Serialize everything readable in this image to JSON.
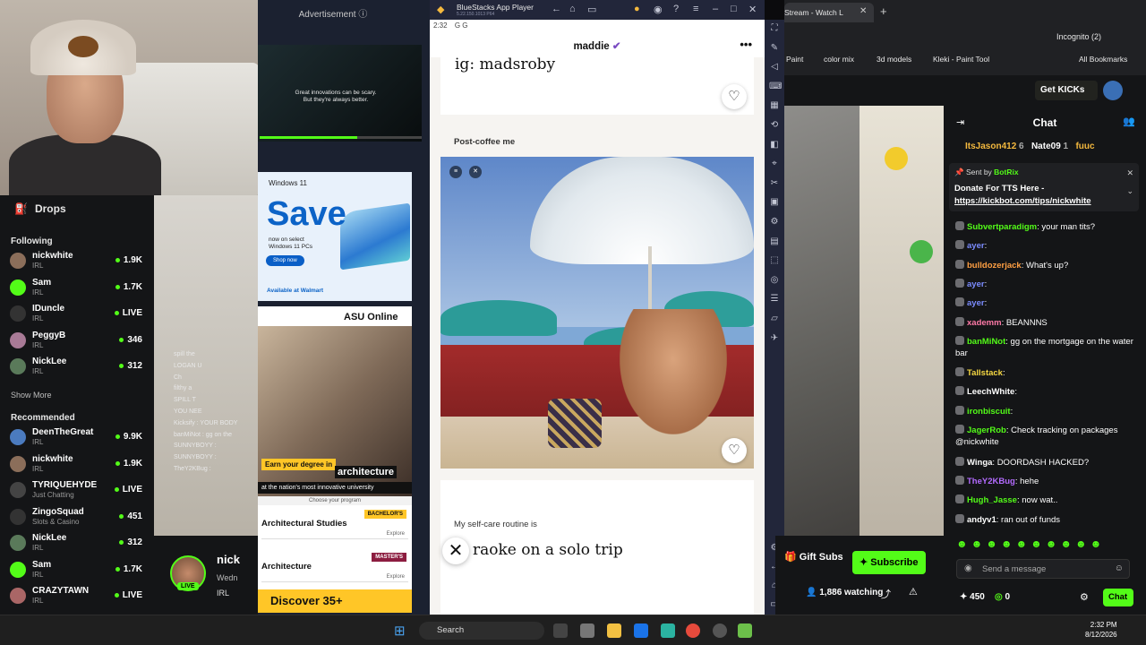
{
  "webcam": {
    "label": "webcam"
  },
  "sidebar": {
    "drops_label": "Drops",
    "following_label": "Following",
    "following": [
      {
        "name": "nickwhite",
        "category": "IRL",
        "count": "1.9K",
        "color": "#8b6e5a"
      },
      {
        "name": "Sam",
        "category": "IRL",
        "count": "1.7K",
        "color": "#53fc18"
      },
      {
        "name": "IDuncle",
        "category": "IRL",
        "count": "LIVE",
        "color": "#333333"
      },
      {
        "name": "PeggyB",
        "category": "IRL",
        "count": "346",
        "color": "#a87a96"
      },
      {
        "name": "NickLee",
        "category": "IRL",
        "count": "312",
        "color": "#5a7a5a"
      }
    ],
    "show_more": "Show More",
    "recommended_label": "Recommended",
    "recommended": [
      {
        "name": "DeenTheGreat",
        "category": "IRL",
        "count": "9.9K",
        "color": "#4b7bbf"
      },
      {
        "name": "nickwhite",
        "category": "IRL",
        "count": "1.9K",
        "color": "#8b6e5a"
      },
      {
        "name": "TYRIQUEHYDE",
        "category": "Just Chatting",
        "count": "LIVE",
        "color": "#444444"
      },
      {
        "name": "ZingoSquad",
        "category": "Slots & Casino",
        "count": "451",
        "color": "#333333"
      },
      {
        "name": "NickLee",
        "category": "IRL",
        "count": "312",
        "color": "#5a7a5a"
      },
      {
        "name": "Sam",
        "category": "IRL",
        "count": "1.7K",
        "color": "#53fc18"
      },
      {
        "name": "CRAZYTAWN",
        "category": "IRL",
        "count": "LIVE",
        "color": "#aa6666"
      }
    ]
  },
  "stream_overlay_chat": [
    "spill the",
    "LOGAN U",
    "Ch",
    "",
    "",
    "filthy a",
    "",
    "SPILL T",
    "YOU NEE",
    "Kicksify : YOUR BODY",
    "banMiNot : gg on the",
    "SUNNYBOYY :",
    "SUNNYBOYY :",
    "TheY2KBug :"
  ],
  "streamer": {
    "name": "nick",
    "date": "Wedn",
    "live": "LIVE",
    "tag": "IRL"
  },
  "ads": {
    "label": "Advertisement ⓘ",
    "video_text_1": "Great innovations can be scary.",
    "video_text_2": "But they're always better.",
    "video_progress": 0.6,
    "windows": {
      "brand": "Windows 11",
      "headline": "Save",
      "copy_1": "now on select",
      "copy_2": "Windows 11 PCs",
      "cta": "Shop now",
      "availability": "Available at Walmart"
    },
    "asu": {
      "logo": "ASU Online",
      "caption": "Earn your degree in",
      "caption_word": "architecture",
      "tagline": "at the nation's most innovative university",
      "choose": "Choose your program",
      "programs": [
        {
          "name": "Architectural Studies",
          "badge": "BACHELOR'S",
          "explore": "Explore"
        },
        {
          "name": "Architecture",
          "badge": "MASTER'S",
          "explore": "Explore"
        }
      ],
      "discover": "Discover 35+"
    }
  },
  "bluestacks": {
    "title": "BlueStacks App Player",
    "version": "5.22.150.1013 P64",
    "status_time": "2:32",
    "profile_name": "maddie",
    "prompt_1_answer": "ig: madsroby",
    "prompt_2_label": "Post-coffee me",
    "prompt_3_label": "My self-care routine is",
    "prompt_3_answer": "raoke on a solo trip"
  },
  "browser": {
    "tab_title": "Stream - Watch L",
    "bookmarks": [
      "Paint",
      "color mix",
      "3d models",
      "Kleki - Paint Tool",
      "All Bookmarks"
    ],
    "incognito": "Incognito (2)",
    "get_kicks": "Get KICKs"
  },
  "video": {
    "gift_subs": "Gift Subs",
    "subscribe": "Subscribe",
    "watching": "1,886 watching"
  },
  "chat": {
    "title": "Chat",
    "top_gifters": [
      {
        "name": "ItsJason412",
        "count": "6"
      },
      {
        "name": "Nate09",
        "count": "1"
      },
      {
        "name": "fuuc",
        "count": ""
      }
    ],
    "pinned_sent_by": "Sent by",
    "pinned_bot": "BotRix",
    "pinned_text": "Donate For TTS Here -",
    "pinned_link": "https://kickbot.com/tips/nickwhite",
    "messages": [
      {
        "user": "Subvertparadigm",
        "text": ": your man tits?",
        "color": "#53fc18"
      },
      {
        "user": "ayer",
        "text": ":",
        "color": "#7b8cff"
      },
      {
        "user": "bulldozerjack",
        "text": ": What's up?",
        "color": "#ff9f43"
      },
      {
        "user": "ayer",
        "text": ":",
        "color": "#7b8cff"
      },
      {
        "user": "ayer",
        "text": ":",
        "color": "#7b8cff"
      },
      {
        "user": "xademm",
        "text": ": BEANNNS",
        "color": "#ff7aa8"
      },
      {
        "user": "banMiNot",
        "text": ": gg on the mortgage on the water bar",
        "color": "#53fc18"
      },
      {
        "user": "Tallstack",
        "text": ":",
        "color": "#f5d742"
      },
      {
        "user": "LeechWhite",
        "text": ":",
        "color": "#ffffff"
      },
      {
        "user": "ironbiscuit",
        "text": ":",
        "color": "#53fc18"
      },
      {
        "user": "JagerRob",
        "text": ": Check tracking on packages @nickwhite",
        "color": "#53fc18"
      },
      {
        "user": "Winga",
        "text": ": DOORDASH HACKED?",
        "color": "#ffffff"
      },
      {
        "user": "TheY2KBug",
        "text": ": hehe",
        "color": "#b36bff"
      },
      {
        "user": "Hugh_Jasse",
        "text": ": now wat..",
        "color": "#53fc18"
      },
      {
        "user": "andyv1",
        "text": ": ran out of funds",
        "color": "#ffffff"
      }
    ],
    "placeholder": "Send a message",
    "kicks_count": "450",
    "points": "0",
    "chat_button": "Chat"
  },
  "taskbar": {
    "search": "Search",
    "time": "2:32 PM",
    "date": "8/12/2026"
  }
}
